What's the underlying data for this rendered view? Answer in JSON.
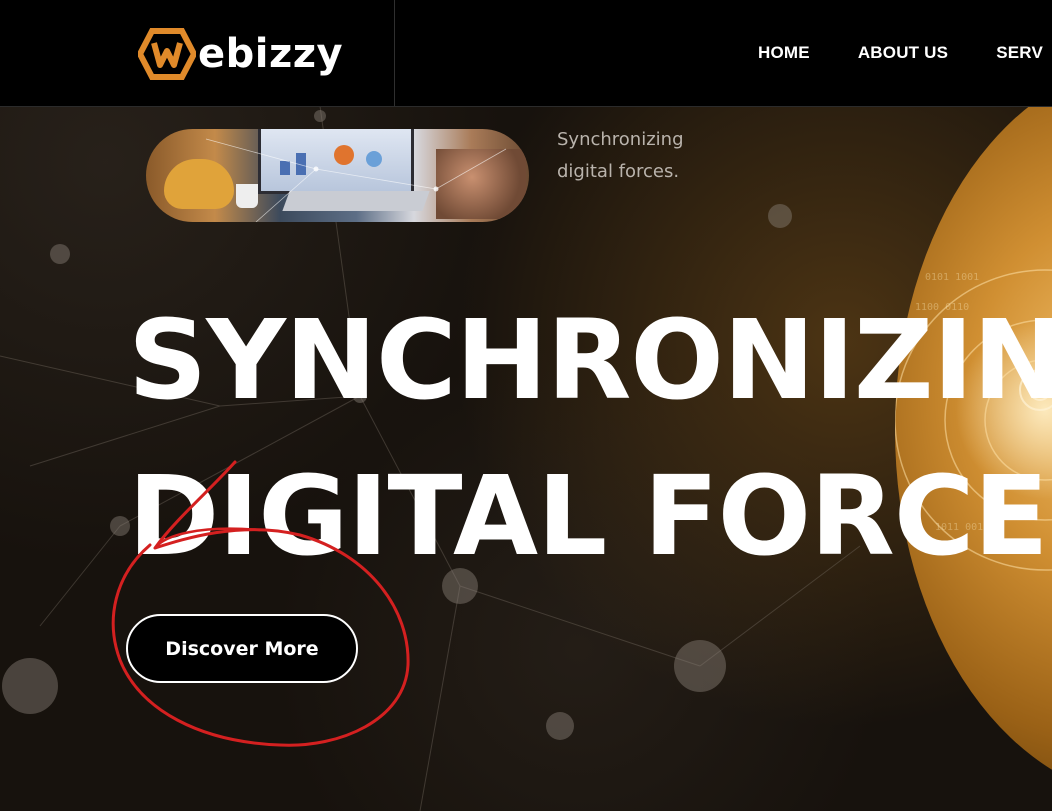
{
  "brand": {
    "logo_text": "ebizzy",
    "logo_color": "#e08a2a"
  },
  "nav": {
    "items": [
      {
        "label": "HOME"
      },
      {
        "label": "ABOUT US"
      },
      {
        "label": "SERV"
      }
    ]
  },
  "hero": {
    "tagline": "Synchronizing digital forces.",
    "headline_line1": "SYNCHRONIZIN",
    "headline_line2": "DIGITAL FORCE",
    "cta_label": "Discover More"
  },
  "colors": {
    "background": "#17120d",
    "header": "#000000",
    "accent_gold": "#d08f32",
    "annotation_red": "#d42020"
  }
}
